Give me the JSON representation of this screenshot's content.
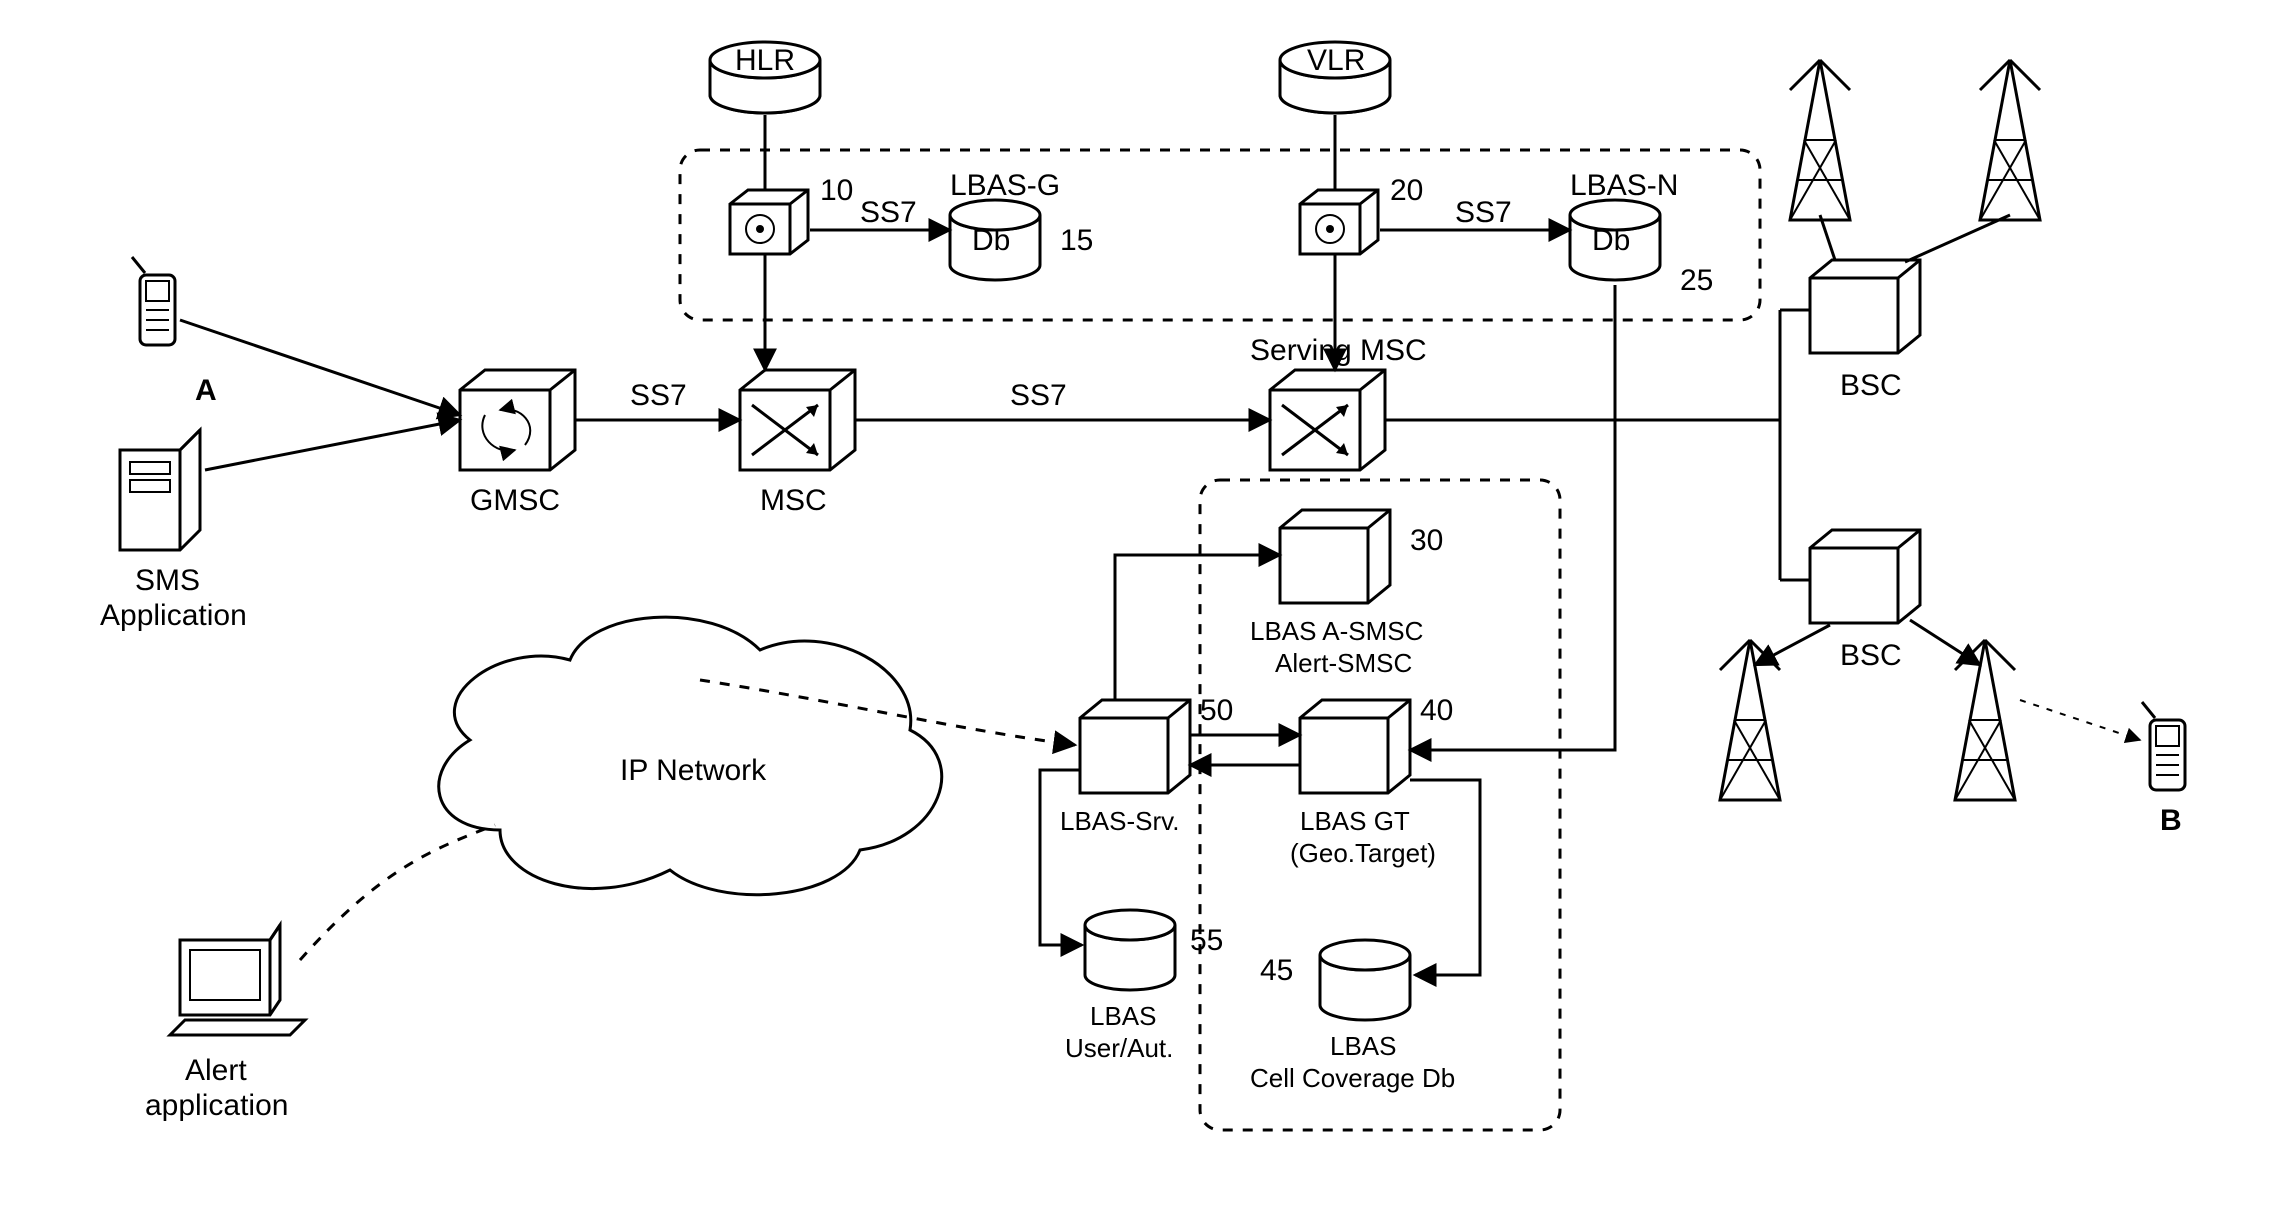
{
  "labels": {
    "A": "A",
    "B": "B",
    "sms_app": "SMS\nApplication",
    "alert_app": "Alert\napplication",
    "gmsc": "GMSC",
    "msc_lbl": "MSC",
    "serving_msc": "Serving MSC",
    "bsc1": "BSC",
    "bsc2": "BSC",
    "hlr": "HLR",
    "vlr": "VLR",
    "ss7_1": "SS7",
    "ss7_2": "SS7",
    "ss7_3": "SS7",
    "ss7_4": "SS7",
    "lbas_g": "LBAS-G\nDb",
    "lbas_n": "LBAS-N\nDb",
    "ip_net": "IP Network",
    "lbas_srv": "LBAS-Srv.",
    "lbas_asmsc_1": "LBAS A-SMSC",
    "lbas_asmsc_2": "Alert-SMSC",
    "lbas_gt_1": "LBAS GT",
    "lbas_gt_2": "(Geo.Target)",
    "lbas_user_aut": "LBAS\nUser/Aut.",
    "lbas_cell_db": "LBAS\nCell Coverage Db",
    "n10": "10",
    "n15": "15",
    "n20": "20",
    "n25": "25",
    "n30": "30",
    "n40": "40",
    "n45": "45",
    "n50": "50",
    "n55": "55"
  }
}
